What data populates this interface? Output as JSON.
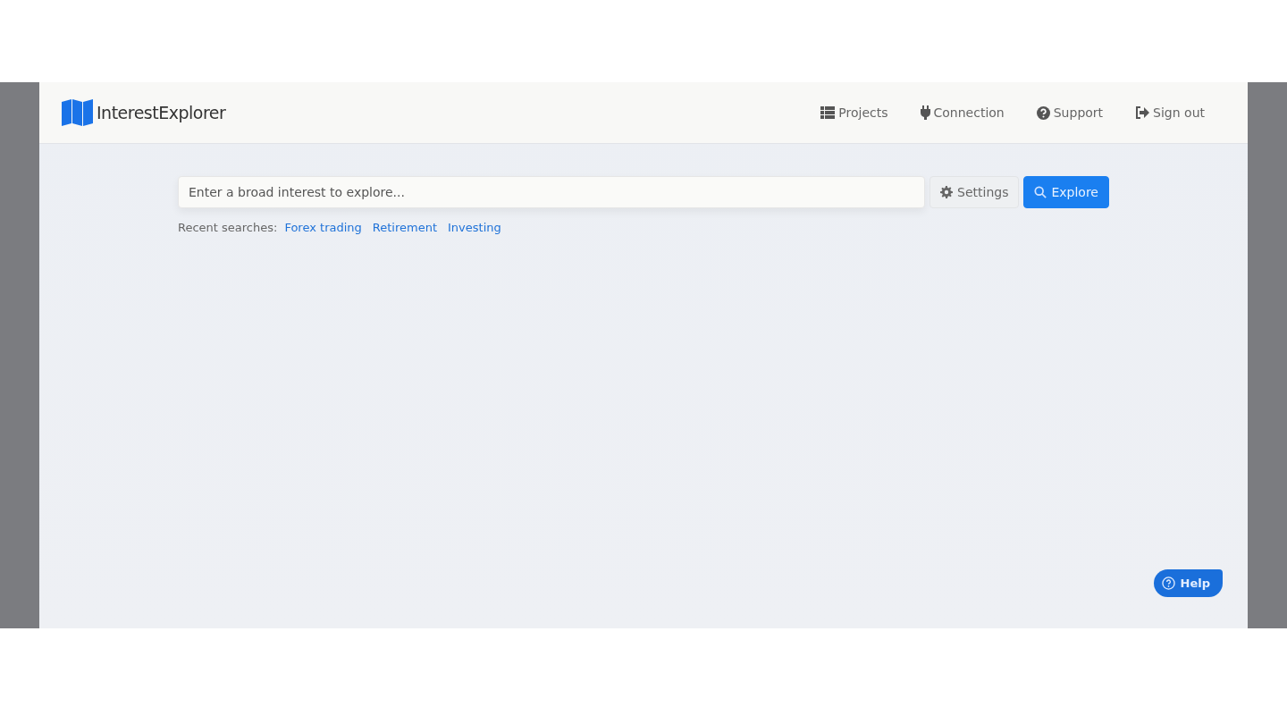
{
  "brand": {
    "name": "InterestExplorer"
  },
  "nav": [
    {
      "label": "Projects"
    },
    {
      "label": "Connection"
    },
    {
      "label": "Support"
    },
    {
      "label": "Sign out"
    }
  ],
  "search": {
    "placeholder": "Enter a broad interest to explore...",
    "settings_button": "Settings",
    "explore_button": "Explore"
  },
  "recent": {
    "label": "Recent searches:",
    "items": [
      "Forex trading",
      "Retirement",
      "Investing"
    ]
  },
  "help_button": "Help"
}
